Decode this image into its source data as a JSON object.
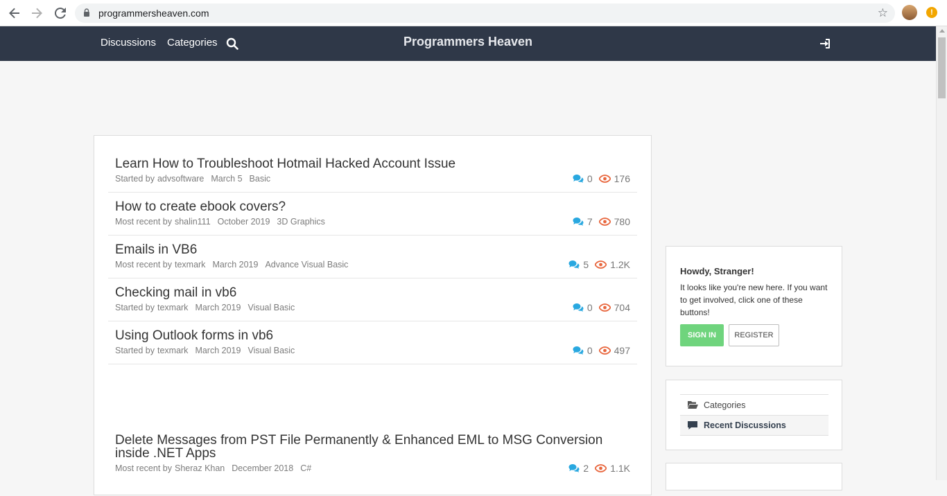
{
  "browser": {
    "url": "programmersheaven.com"
  },
  "header": {
    "nav": [
      "Discussions",
      "Categories"
    ],
    "brand": "Programmers Heaven"
  },
  "discussions": [
    {
      "title": "Learn How to Troubleshoot Hotmail Hacked Account Issue",
      "prefix": "Started by",
      "author": "advsoftware",
      "date": "March 5",
      "category": "Basic",
      "comments": "0",
      "views": "176"
    },
    {
      "title": "How to create ebook covers?",
      "prefix": "Most recent by",
      "author": "shalin111",
      "date": "October 2019",
      "category": "3D Graphics",
      "comments": "7",
      "views": "780"
    },
    {
      "title": "Emails in VB6",
      "prefix": "Most recent by",
      "author": "texmark",
      "date": "March 2019",
      "category": "Advance Visual Basic",
      "comments": "5",
      "views": "1.2K"
    },
    {
      "title": "Checking mail in vb6",
      "prefix": "Started by",
      "author": "texmark",
      "date": "March 2019",
      "category": "Visual Basic",
      "comments": "0",
      "views": "704"
    },
    {
      "title": "Using Outlook forms in vb6",
      "prefix": "Started by",
      "author": "texmark",
      "date": "March 2019",
      "category": "Visual Basic",
      "comments": "0",
      "views": "497"
    },
    {
      "title": "Delete Messages from PST File Permanently & Enhanced EML to MSG Conversion inside .NET Apps",
      "prefix": "Most recent by",
      "author": "Sheraz Khan",
      "date": "December 2018",
      "category": "C#",
      "comments": "2",
      "views": "1.1K"
    }
  ],
  "sidebar": {
    "howdy_title": "Howdy, Stranger!",
    "howdy_text": "It looks like you're new here. If you want to get involved, click one of these buttons!",
    "sign_in": "Sign In",
    "register": "Register",
    "links": [
      "Categories",
      "Recent Discussions"
    ]
  },
  "colors": {
    "header_bg": "#2f3848",
    "comment_icon": "#29a8e0",
    "view_icon": "#e8663d",
    "sign_in_bg": "#6fd47d"
  }
}
